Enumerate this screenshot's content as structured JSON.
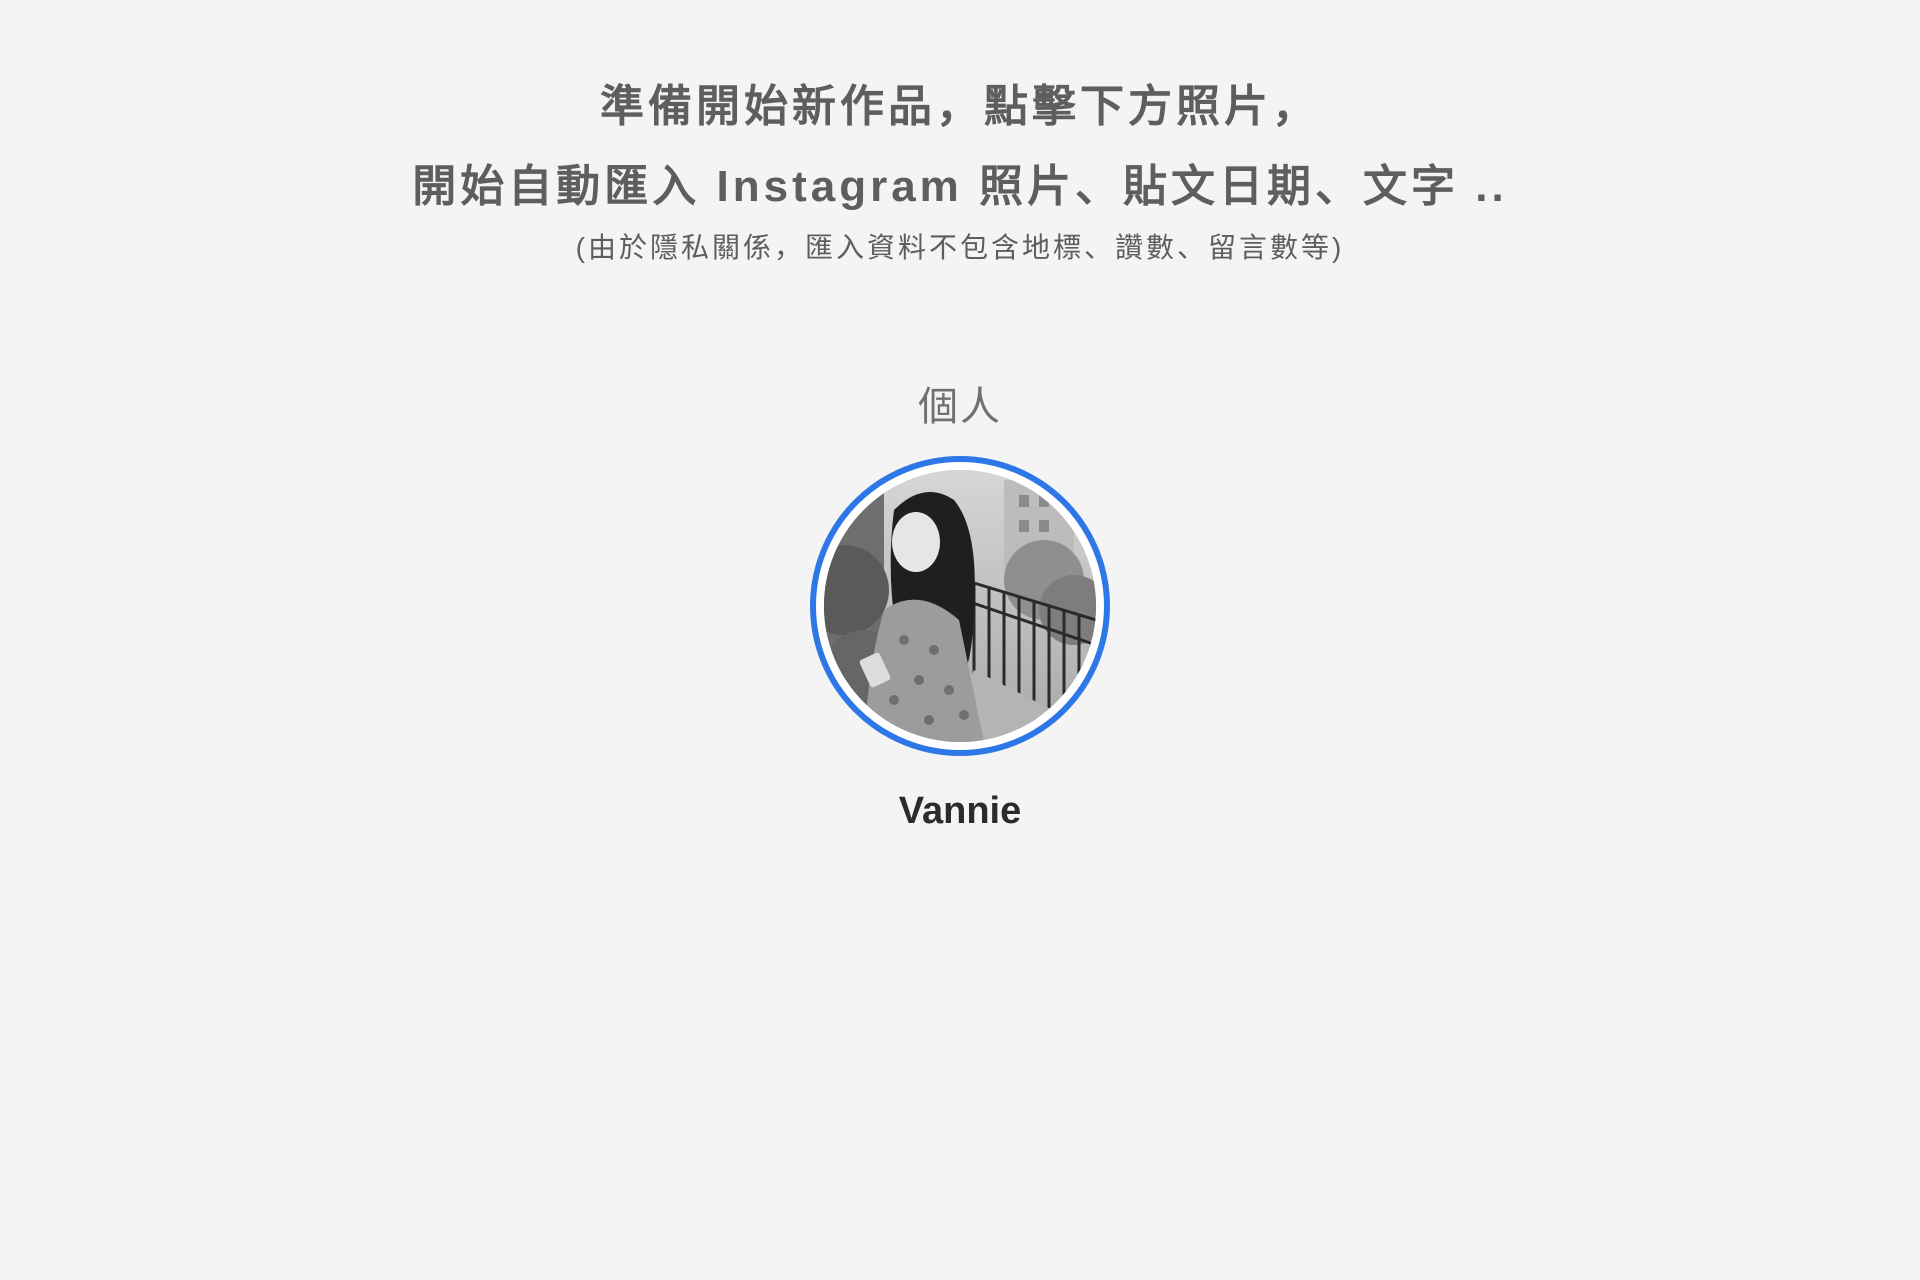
{
  "header": {
    "line1": "準備開始新作品，點擊下方照片，",
    "line2": "開始自動匯入 Instagram 照片、貼文日期、文字 ..",
    "note": "(由於隱私關係，匯入資料不包含地標、讚數、留言數等)"
  },
  "section": {
    "label": "個人"
  },
  "profiles": [
    {
      "name": "Vannie",
      "avatar_icon": "profile-photo",
      "ring_color": "#2e77e6"
    }
  ]
}
